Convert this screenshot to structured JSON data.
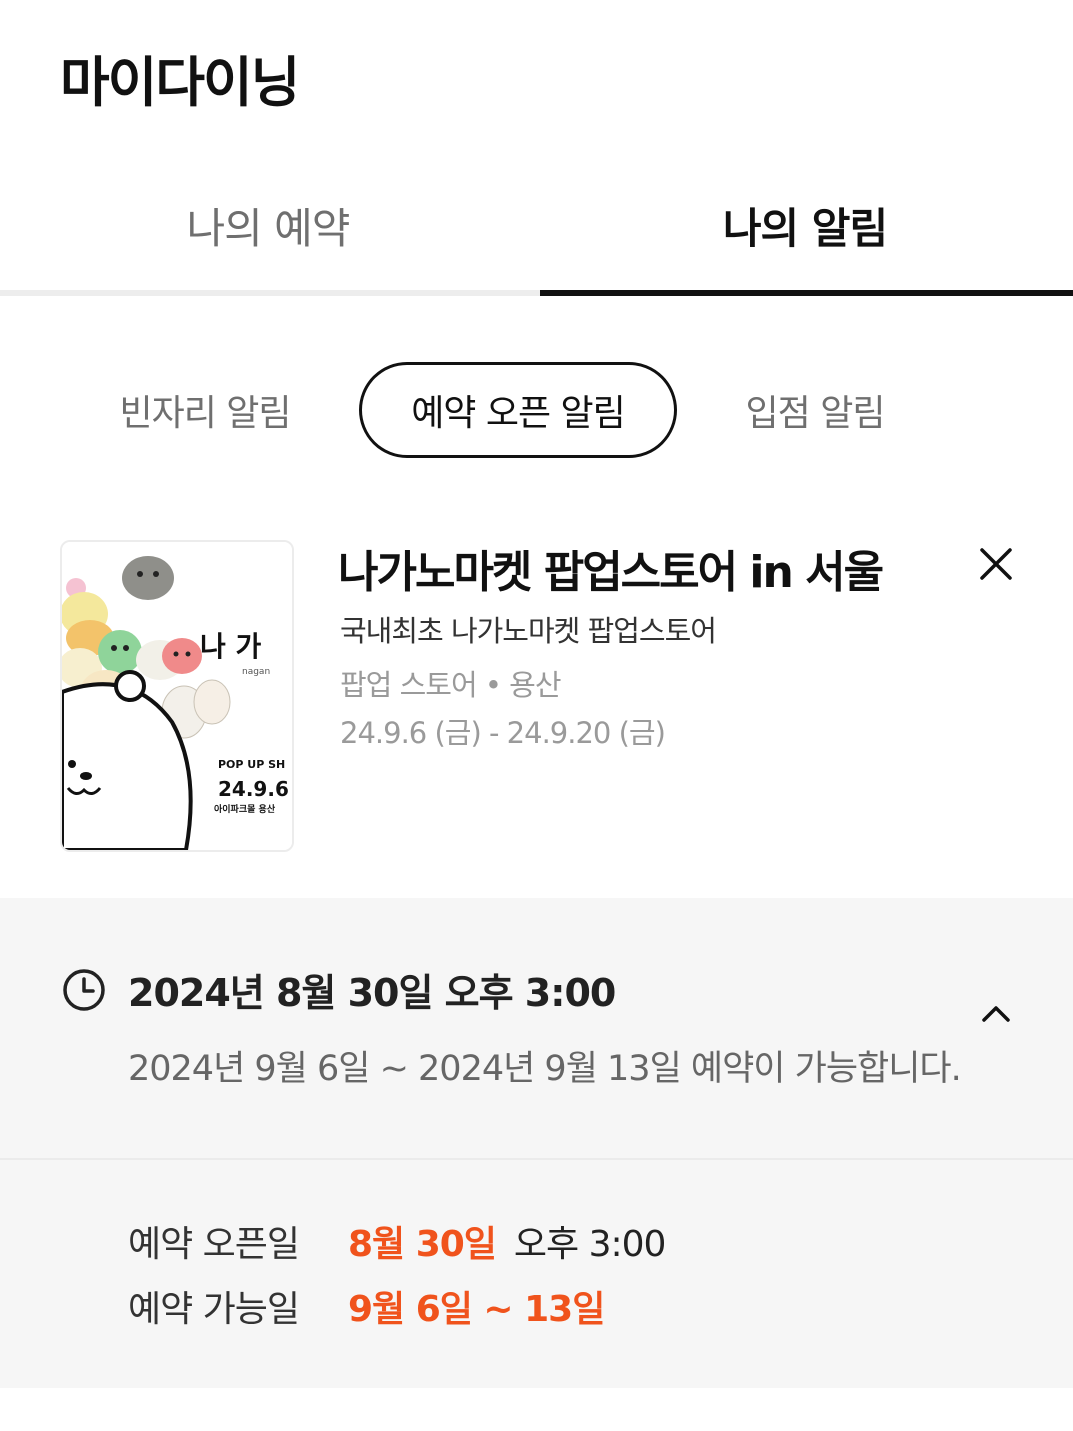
{
  "header": {
    "title": "마이다이닝"
  },
  "tabs": [
    {
      "label": "나의 예약",
      "active": false
    },
    {
      "label": "나의 알림",
      "active": true
    }
  ],
  "chips": [
    {
      "label": "빈자리 알림",
      "selected": false
    },
    {
      "label": "예약 오픈 알림",
      "selected": true
    },
    {
      "label": "입점 알림",
      "selected": false
    }
  ],
  "card": {
    "title": "나가노마켓 팝업스토어 in 서울",
    "subtitle": "국내최초 나가노마켓 팝업스토어",
    "meta": "팝업 스토어 • 용산",
    "period": "24.9.6 (금) - 24.9.20 (금)",
    "thumb": {
      "big_text": "나 가",
      "small_text": "nagan",
      "popup_text": "POP UP SH",
      "date_text": "24.9.6",
      "venue_text": "아이파크몰 용산"
    },
    "close_icon": "close-icon"
  },
  "info": {
    "open_datetime": "2024년 8월 30일  오후 3:00",
    "description": "2024년 9월 6일 ~ 2024년 9월 13일 예약이 가능합니다.",
    "rows": [
      {
        "label": "예약 오픈일",
        "highlight": "8월 30일",
        "extra": "오후 3:00"
      },
      {
        "label": "예약 가능일",
        "highlight": "9월 6일 ~ 13일",
        "extra": ""
      }
    ],
    "icons": {
      "clock": "clock-icon",
      "toggle": "chevron-up-icon"
    }
  },
  "colors": {
    "accent": "#f0531c",
    "active_tab_underline": "#111111"
  }
}
